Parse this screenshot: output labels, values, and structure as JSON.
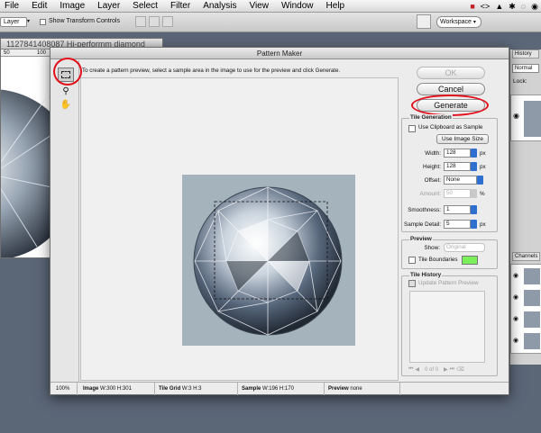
{
  "menubar": {
    "items": [
      "File",
      "Edit",
      "Image",
      "Layer",
      "Select",
      "Filter",
      "Analysis",
      "View",
      "Window",
      "Help"
    ]
  },
  "options": {
    "layer_dropdown": "Layer",
    "show_transform": "Show Transform Controls",
    "workspace": "Workspace"
  },
  "background_doc": {
    "title": "1127841408087 Hi-performm diamond",
    "ruler_marks": [
      "50",
      "100"
    ]
  },
  "right_panel": {
    "tab_history": "History",
    "blend_mode": "Normal",
    "lock_label": "Lock:",
    "tab_channels": "Channels"
  },
  "dialog": {
    "title": "Pattern Maker",
    "instruction": "To create a pattern preview, select a sample area in the image to use for the preview and click Generate.",
    "buttons": {
      "ok": "OK",
      "cancel": "Cancel",
      "generate": "Generate"
    },
    "tile_generation": {
      "title": "Tile Generation",
      "use_clipboard": "Use Clipboard as Sample",
      "use_image_size": "Use Image Size",
      "width_label": "Width:",
      "width_value": "128",
      "height_label": "Height:",
      "height_value": "128",
      "offset_label": "Offset:",
      "offset_value": "None",
      "amount_label": "Amount:",
      "amount_value": "50",
      "smoothness_label": "Smoothness:",
      "smoothness_value": "1",
      "sample_detail_label": "Sample Detail:",
      "sample_detail_value": "5",
      "unit_px": "px",
      "unit_pct": "%"
    },
    "preview_group": {
      "title": "Preview",
      "show_label": "Show:",
      "show_value": "Original",
      "tile_boundaries": "Tile Boundaries",
      "boundary_color": "#7cf05a"
    },
    "tile_history": {
      "title": "Tile History",
      "update_preview": "Update Pattern Preview",
      "counter": "0 of 0"
    },
    "status": {
      "zoom": "100%",
      "image_label": "Image",
      "image_value": "W:300 H:301",
      "tilegrid_label": "Tile Grid",
      "tilegrid_value": "W:3 H:3",
      "sample_label": "Sample",
      "sample_value": "W:196 H:170",
      "preview_label": "Preview",
      "preview_value": "none"
    }
  },
  "colors": {
    "annotation_ring": "#e2101b",
    "preview_bg": "#a5b3bc",
    "desktop": "#5b6677"
  }
}
